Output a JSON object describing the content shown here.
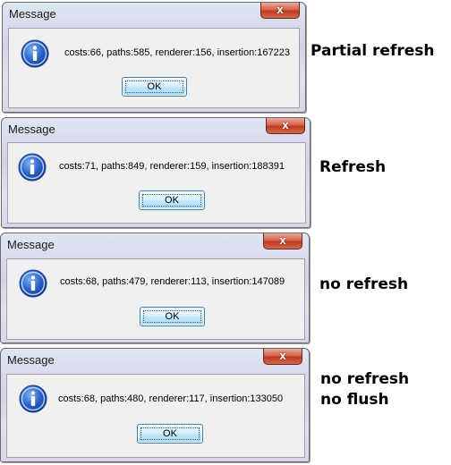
{
  "dialogs": [
    {
      "title": "Message",
      "close_glyph": "x",
      "icon": "information-icon",
      "message": "costs:66, paths:585, renderer:156, insertion:167223",
      "button": "OK"
    },
    {
      "title": "Message",
      "close_glyph": "x",
      "icon": "information-icon",
      "message": "costs:71, paths:849, renderer:159, insertion:188391",
      "button": "OK"
    },
    {
      "title": "Message",
      "close_glyph": "x",
      "icon": "information-icon",
      "message": "costs:68, paths:479, renderer:113, insertion:147089",
      "button": "OK"
    },
    {
      "title": "Message",
      "close_glyph": "x",
      "icon": "information-icon",
      "message": "costs:68, paths:480, renderer:117, insertion:133050",
      "button": "OK"
    }
  ],
  "labels": [
    {
      "line1": "Partial refresh"
    },
    {
      "line1": "Refresh"
    },
    {
      "line1": "no refresh"
    },
    {
      "line1": "no refresh",
      "line2": "no flush"
    }
  ]
}
